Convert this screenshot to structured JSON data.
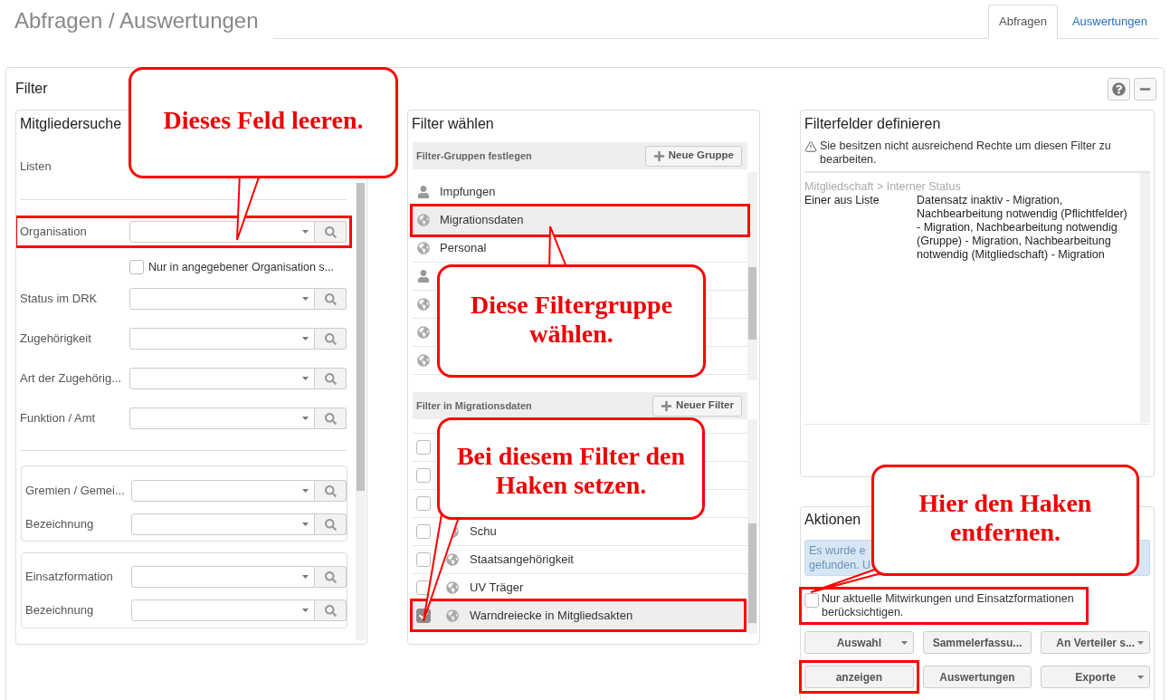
{
  "page": {
    "title": "Abfragen / Auswertungen"
  },
  "tabs": [
    {
      "label": "Abfragen",
      "selected": true
    },
    {
      "label": "Auswertungen",
      "selected": false
    }
  ],
  "filter_panel": {
    "title": "Filter"
  },
  "member_search": {
    "title": "Mitgliedersuche",
    "lists_label": "Listen",
    "fields": [
      {
        "kind": "combo",
        "label": "Organisation",
        "highlighted": true
      },
      {
        "kind": "checkbox",
        "label": "Nur in angegebener Organisation s...",
        "checked": false
      },
      {
        "kind": "combo",
        "label": "Status im DRK",
        "highlighted": false
      },
      {
        "kind": "combo",
        "label": "Zugehörigkeit",
        "highlighted": false
      },
      {
        "kind": "combo",
        "label": "Art der Zugehörig...",
        "highlighted": false
      },
      {
        "kind": "combo",
        "label": "Funktion / Amt",
        "highlighted": false
      }
    ],
    "groups": [
      {
        "fields": [
          {
            "label": "Gremien / Gemei..."
          },
          {
            "label": "Bezeichnung"
          }
        ]
      },
      {
        "fields": [
          {
            "label": "Einsatzformation"
          },
          {
            "label": "Bezeichnung"
          }
        ]
      }
    ]
  },
  "filter_select": {
    "title": "Filter wählen",
    "groups_header": "Filter-Gruppen festlegen",
    "new_group_button": "Neue Gruppe",
    "groups": [
      {
        "kind": "person",
        "label": "Impfungen",
        "selected": false,
        "highlighted": false
      },
      {
        "kind": "globe",
        "label": "Migrationsdaten",
        "selected": true,
        "highlighted": true
      },
      {
        "kind": "globe",
        "label": "Personal",
        "selected": false,
        "highlighted": false
      },
      {
        "kind": "person",
        "selected": false
      },
      {
        "kind": "globe",
        "selected": false
      },
      {
        "kind": "globe",
        "selected": false
      },
      {
        "kind": "globe",
        "selected": false
      }
    ],
    "filters_header": "Filter in Migrationsdaten",
    "new_filter_button": "Neuer Filter",
    "filters": [
      {
        "checked": false,
        "highlighted": false
      },
      {
        "checked": false,
        "highlighted": false
      },
      {
        "checked": false,
        "highlighted": false
      },
      {
        "label": "Schu",
        "checked": false,
        "highlighted": false
      },
      {
        "label": "Staatsangehörigkeit",
        "checked": false,
        "highlighted": false
      },
      {
        "label": "UV Träger",
        "checked": false,
        "highlighted": false
      },
      {
        "label": "Warndreiecke in Mitgliedsakten",
        "checked": true,
        "highlighted": true
      }
    ]
  },
  "filter_fields": {
    "title": "Filterfelder definieren",
    "warning": "Sie besitzen nicht ausreichend Rechte um diesen Filter zu bearbeiten.",
    "path": "Mitgliedschaft > Interner Status",
    "operator": "Einer aus Liste",
    "value": "Datensatz inaktiv - Migration, Nachbearbeitung notwendig (Pflichtfelder) - Migration, Nachbearbeitung notwendig (Gruppe) - Migration, Nachbearbeitung notwendig (Mitgliedschaft) - Migration"
  },
  "actions": {
    "title": "Aktionen",
    "info_lines": [
      "Es wurde e",
      "gefunden. U"
    ],
    "current_only": {
      "label": "Nur aktuelle Mitwirkungen und Einsatzformationen berücksichtigen.",
      "checked": false,
      "highlighted": true
    },
    "buttons": [
      {
        "label": "Auswahl",
        "dropdown": true,
        "highlighted": false
      },
      {
        "label": "Sammelerfassu...",
        "dropdown": false,
        "highlighted": false
      },
      {
        "label": "An Verteiler s...",
        "dropdown": true,
        "highlighted": false
      },
      {
        "label": "anzeigen",
        "dropdown": false,
        "highlighted": true
      },
      {
        "label": "Auswertungen",
        "dropdown": false,
        "highlighted": false
      },
      {
        "label": "Exporte",
        "dropdown": true,
        "highlighted": false
      }
    ]
  },
  "callouts": [
    {
      "text": "Dieses Feld leeren."
    },
    {
      "text": "Diese Filtergruppe wählen."
    },
    {
      "text": "Bei diesem Filter den Haken setzen."
    },
    {
      "text": "Hier den Haken entfernen."
    }
  ]
}
